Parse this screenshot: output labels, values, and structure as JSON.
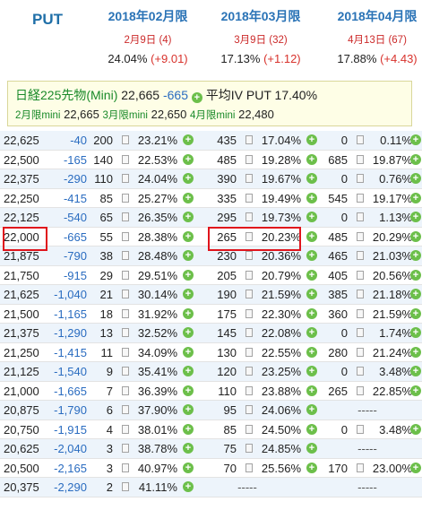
{
  "header": {
    "put_label": "PUT",
    "months": [
      {
        "title": "2018年02月限",
        "date": "2月9日 (4)",
        "iv": "24.04%",
        "change": "(+9.01)"
      },
      {
        "title": "2018年03月限",
        "date": "3月9日 (32)",
        "iv": "17.13%",
        "change": "(+1.12)"
      },
      {
        "title": "2018年04月限",
        "date": "4月13日 (67)",
        "iv": "17.88%",
        "change": "(+4.43)"
      }
    ]
  },
  "futures": {
    "name": "日経225先物(Mini)",
    "price": "22,665",
    "change": "-665",
    "avg_iv_label": "平均IV",
    "put_label": "PUT",
    "avg_iv": "17.40%",
    "mini": [
      {
        "label": "2月限mini",
        "value": "22,665"
      },
      {
        "label": "3月限mini",
        "value": "22,650"
      },
      {
        "label": "4月限mini",
        "value": "22,480"
      }
    ]
  },
  "rows": [
    {
      "strike": "22,625",
      "chg": "-40",
      "m": [
        {
          "v": "200",
          "iv": "23.21%"
        },
        {
          "v": "435",
          "iv": "17.04%"
        },
        {
          "v": "0",
          "iv": "0.11%"
        }
      ]
    },
    {
      "strike": "22,500",
      "chg": "-165",
      "m": [
        {
          "v": "140",
          "iv": "22.53%"
        },
        {
          "v": "485",
          "iv": "19.28%"
        },
        {
          "v": "685",
          "iv": "19.87%"
        }
      ]
    },
    {
      "strike": "22,375",
      "chg": "-290",
      "m": [
        {
          "v": "110",
          "iv": "24.04%"
        },
        {
          "v": "390",
          "iv": "19.67%"
        },
        {
          "v": "0",
          "iv": "0.76%"
        }
      ]
    },
    {
      "strike": "22,250",
      "chg": "-415",
      "m": [
        {
          "v": "85",
          "iv": "25.27%"
        },
        {
          "v": "335",
          "iv": "19.49%"
        },
        {
          "v": "545",
          "iv": "19.17%"
        }
      ]
    },
    {
      "strike": "22,125",
      "chg": "-540",
      "m": [
        {
          "v": "65",
          "iv": "26.35%"
        },
        {
          "v": "295",
          "iv": "19.73%"
        },
        {
          "v": "0",
          "iv": "1.13%"
        }
      ]
    },
    {
      "strike": "22,000",
      "chg": "-665",
      "m": [
        {
          "v": "55",
          "iv": "28.38%"
        },
        {
          "v": "265",
          "iv": "20.23%"
        },
        {
          "v": "485",
          "iv": "20.29%"
        }
      ]
    },
    {
      "strike": "21,875",
      "chg": "-790",
      "m": [
        {
          "v": "38",
          "iv": "28.48%"
        },
        {
          "v": "230",
          "iv": "20.36%"
        },
        {
          "v": "465",
          "iv": "21.03%"
        }
      ]
    },
    {
      "strike": "21,750",
      "chg": "-915",
      "m": [
        {
          "v": "29",
          "iv": "29.51%"
        },
        {
          "v": "205",
          "iv": "20.79%"
        },
        {
          "v": "405",
          "iv": "20.56%"
        }
      ]
    },
    {
      "strike": "21,625",
      "chg": "-1,040",
      "m": [
        {
          "v": "21",
          "iv": "30.14%"
        },
        {
          "v": "190",
          "iv": "21.59%"
        },
        {
          "v": "385",
          "iv": "21.18%"
        }
      ]
    },
    {
      "strike": "21,500",
      "chg": "-1,165",
      "m": [
        {
          "v": "18",
          "iv": "31.92%"
        },
        {
          "v": "175",
          "iv": "22.30%"
        },
        {
          "v": "360",
          "iv": "21.59%"
        }
      ]
    },
    {
      "strike": "21,375",
      "chg": "-1,290",
      "m": [
        {
          "v": "13",
          "iv": "32.52%"
        },
        {
          "v": "145",
          "iv": "22.08%"
        },
        {
          "v": "0",
          "iv": "1.74%"
        }
      ]
    },
    {
      "strike": "21,250",
      "chg": "-1,415",
      "m": [
        {
          "v": "11",
          "iv": "34.09%"
        },
        {
          "v": "130",
          "iv": "22.55%"
        },
        {
          "v": "280",
          "iv": "21.24%"
        }
      ]
    },
    {
      "strike": "21,125",
      "chg": "-1,540",
      "m": [
        {
          "v": "9",
          "iv": "35.41%"
        },
        {
          "v": "120",
          "iv": "23.25%"
        },
        {
          "v": "0",
          "iv": "3.48%"
        }
      ]
    },
    {
      "strike": "21,000",
      "chg": "-1,665",
      "m": [
        {
          "v": "7",
          "iv": "36.39%"
        },
        {
          "v": "110",
          "iv": "23.88%"
        },
        {
          "v": "265",
          "iv": "22.85%"
        }
      ]
    },
    {
      "strike": "20,875",
      "chg": "-1,790",
      "m": [
        {
          "v": "6",
          "iv": "37.90%"
        },
        {
          "v": "95",
          "iv": "24.06%"
        },
        {
          "dash": "-----"
        }
      ]
    },
    {
      "strike": "20,750",
      "chg": "-1,915",
      "m": [
        {
          "v": "4",
          "iv": "38.01%"
        },
        {
          "v": "85",
          "iv": "24.50%"
        },
        {
          "v": "0",
          "iv": "3.48%"
        }
      ]
    },
    {
      "strike": "20,625",
      "chg": "-2,040",
      "m": [
        {
          "v": "3",
          "iv": "38.78%"
        },
        {
          "v": "75",
          "iv": "24.85%"
        },
        {
          "dash": "-----"
        }
      ]
    },
    {
      "strike": "20,500",
      "chg": "-2,165",
      "m": [
        {
          "v": "3",
          "iv": "40.97%"
        },
        {
          "v": "70",
          "iv": "25.56%"
        },
        {
          "v": "170",
          "iv": "23.00%"
        }
      ]
    },
    {
      "strike": "20,375",
      "chg": "-2,290",
      "m": [
        {
          "v": "2",
          "iv": "41.11%"
        },
        {
          "dash": "-----"
        },
        {
          "dash": "-----"
        }
      ]
    }
  ],
  "colors": {
    "accent_blue": "#2a73b6",
    "negative": "#2a6cc0",
    "positive_change": "#d8322c",
    "highlight": "#e0141c",
    "plus_icon": "#6cbf4a"
  }
}
